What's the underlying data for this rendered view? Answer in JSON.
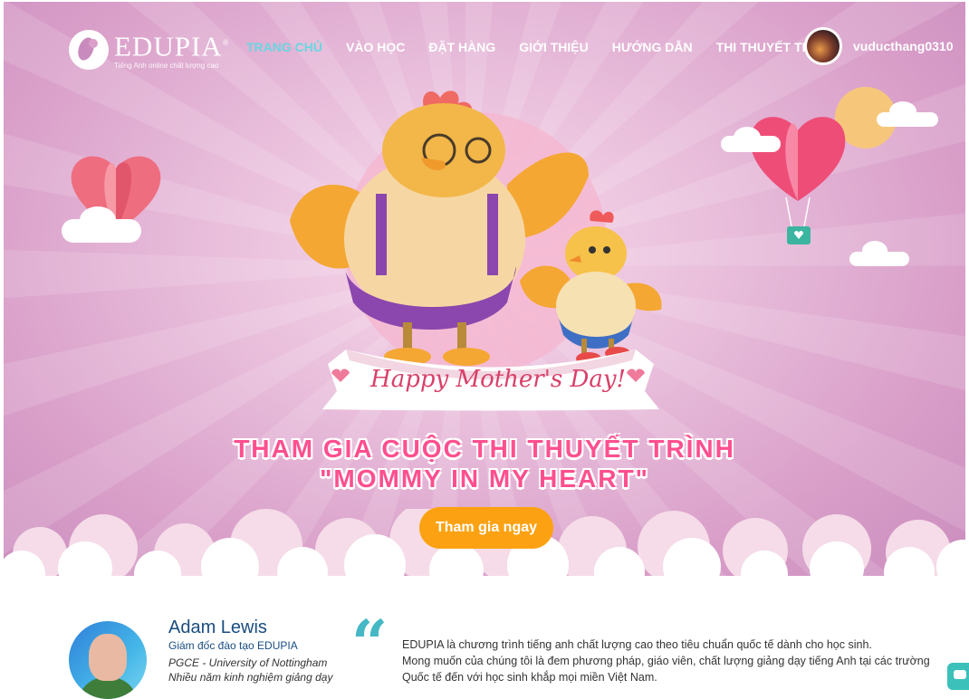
{
  "brand": {
    "name": "EDUPIA",
    "registered": "®",
    "tagline": "Tiếng Anh online chất lượng cao"
  },
  "nav": {
    "items": [
      {
        "label": "TRANG CHỦ",
        "active": true
      },
      {
        "label": "VÀO HỌC",
        "active": false
      },
      {
        "label": "ĐẶT HÀNG",
        "active": false
      },
      {
        "label": "GIỚI THIỆU",
        "active": false
      },
      {
        "label": "HƯỚNG DẪN",
        "active": false
      },
      {
        "label": "THI THUYẾT TRÌNH",
        "active": false
      }
    ]
  },
  "user": {
    "username": "vuducthang0310"
  },
  "hero": {
    "banner_text": "Happy Mother's Day!",
    "headline_line1": "THAM GIA CUỘC THI THUYẾT TRÌNH",
    "headline_line2": "\"MOMMY IN MY HEART\"",
    "cta_label": "Tham gia ngay"
  },
  "teacher": {
    "name": "Adam Lewis",
    "role": "Giám đốc đào tạo EDUPIA",
    "qualification": "PGCE - University of Nottingham",
    "experience": "Nhiều năm kinh nghiệm giảng dạy"
  },
  "about": {
    "line1": "EDUPIA là chương trình tiếng anh chất lượng cao theo tiêu chuẩn quốc tế dành cho học sinh.",
    "line2": "Mong muốn của chúng tôi là đem phương pháp, giáo viên, chất lượng giảng dạy tiếng Anh tại các trường",
    "line3": "Quốc tế đến với học sinh khắp mọi miền Việt Nam."
  },
  "colors": {
    "hero_bg": "#d99fc9",
    "nav_active": "#67d7e0",
    "headline": "#ff4f8f",
    "cta": "#fca212",
    "teacher_name": "#1a4d80",
    "quote_accent": "#45b8c5",
    "chat_button": "#3bc1b9"
  },
  "icons": {
    "logo": "edupia-logo-icon",
    "quote": "quote-icon",
    "chat": "chat-bubble-icon"
  }
}
